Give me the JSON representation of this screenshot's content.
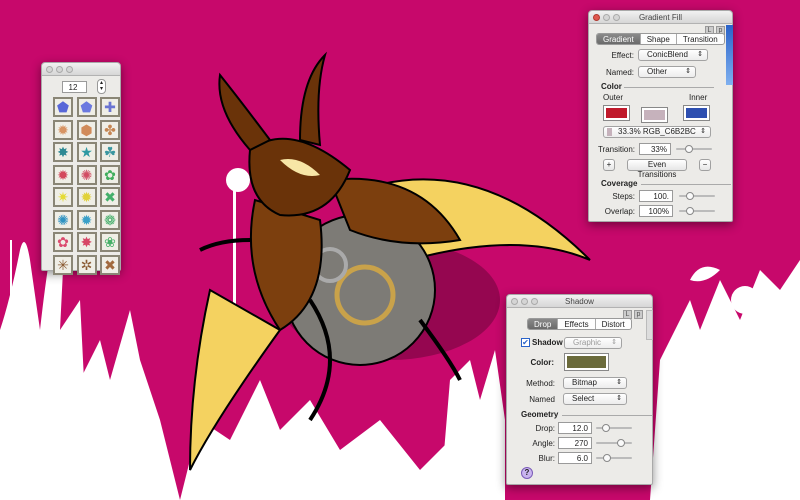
{
  "colors": {
    "background": "#c7086b",
    "accent": "#2a63c9"
  },
  "shape_palette": {
    "count_value": "12",
    "shapes": [
      {
        "icon": "pentagon-icon",
        "glyph": "⬟",
        "color": "#5867d8"
      },
      {
        "icon": "rounded-pentagon-icon",
        "glyph": "⬟",
        "color": "#6b79e0"
      },
      {
        "icon": "four-point-star-icon",
        "glyph": "✚",
        "color": "#6a74d2"
      },
      {
        "icon": "heptagon-icon",
        "glyph": "✹",
        "color": "#d79463"
      },
      {
        "icon": "hexagon-icon",
        "glyph": "⬢",
        "color": "#d18b5a"
      },
      {
        "icon": "triskelion-icon",
        "glyph": "✤",
        "color": "#c48552"
      },
      {
        "icon": "spiky-star-icon",
        "glyph": "✸",
        "color": "#2f8a94"
      },
      {
        "icon": "star-icon",
        "glyph": "★",
        "color": "#2e9aa3"
      },
      {
        "icon": "trefoil-icon",
        "glyph": "☘",
        "color": "#3a97a0"
      },
      {
        "icon": "burst-icon",
        "glyph": "✹",
        "color": "#d3475b"
      },
      {
        "icon": "burst-round-icon",
        "glyph": "✺",
        "color": "#d24c63"
      },
      {
        "icon": "flower-icon",
        "glyph": "✿",
        "color": "#3fae5c"
      },
      {
        "icon": "yellow-star-icon",
        "glyph": "✷",
        "color": "#e5db35"
      },
      {
        "icon": "sun-icon",
        "glyph": "✹",
        "color": "#e1d23a"
      },
      {
        "icon": "x-star-icon",
        "glyph": "✖",
        "color": "#43b06a"
      },
      {
        "icon": "gear-flower-icon",
        "glyph": "✺",
        "color": "#2f93c2"
      },
      {
        "icon": "gear-icon",
        "glyph": "✹",
        "color": "#3aa0c8"
      },
      {
        "icon": "round-flower-icon",
        "glyph": "❁",
        "color": "#3bab63"
      },
      {
        "icon": "pink-flower-icon",
        "glyph": "✿",
        "color": "#db4a6e"
      },
      {
        "icon": "pink-star-icon",
        "glyph": "✸",
        "color": "#d74766"
      },
      {
        "icon": "green-flower-icon",
        "glyph": "❀",
        "color": "#45b067"
      },
      {
        "icon": "sparkle-icon",
        "glyph": "✳",
        "color": "#8a5a32"
      },
      {
        "icon": "swirl-icon",
        "glyph": "✲",
        "color": "#8a5a32"
      },
      {
        "icon": "cross-icon",
        "glyph": "✖",
        "color": "#a26a3e"
      }
    ]
  },
  "gradient_panel": {
    "title": "Gradient Fill",
    "mini_buttons": [
      "L",
      "p"
    ],
    "tabs": [
      "Gradient",
      "Shape",
      "Transition"
    ],
    "effect_label": "Effect:",
    "effect_value": "ConicBlend",
    "named_label": "Named:",
    "named_value": "Other",
    "color_section": "Color",
    "outer_label": "Outer",
    "inner_label": "Inner",
    "outer_color": "#c0192b",
    "mid_color": "#c6b2bc",
    "inner_color": "#2e4fb0",
    "stop_value": "33.3% RGB_C6B2BC",
    "transition_label": "Transition:",
    "transition_value": "33%",
    "transition_slider": 0.33,
    "plus_label": "+",
    "even_label": "Even Transitions",
    "minus_label": "−",
    "coverage_section": "Coverage",
    "steps_label": "Steps:",
    "steps_value": "100.",
    "steps_slider": 0.25,
    "overlap_label": "Overlap:",
    "overlap_value": "100%",
    "overlap_slider": 0.25
  },
  "shadow_panel": {
    "title": "Shadow",
    "mini_buttons": [
      "L",
      "p"
    ],
    "tabs": [
      "Drop",
      "Effects",
      "Distort"
    ],
    "shadow_label": "Shadow",
    "shadow_checked": true,
    "shadow_type": "Graphic",
    "color_label": "Color:",
    "color_value": "#6b6b3b",
    "method_label": "Method:",
    "method_value": "Bitmap",
    "named_label": "Named",
    "named_value": "Select",
    "geometry_section": "Geometry",
    "drop_label": "Drop:",
    "drop_value": "12.0",
    "drop_slider": 0.2,
    "angle_label": "Angle:",
    "angle_value": "270",
    "angle_slider": 0.75,
    "blur_label": "Blur:",
    "blur_value": "6.0",
    "blur_slider": 0.25,
    "help_label": "?"
  }
}
